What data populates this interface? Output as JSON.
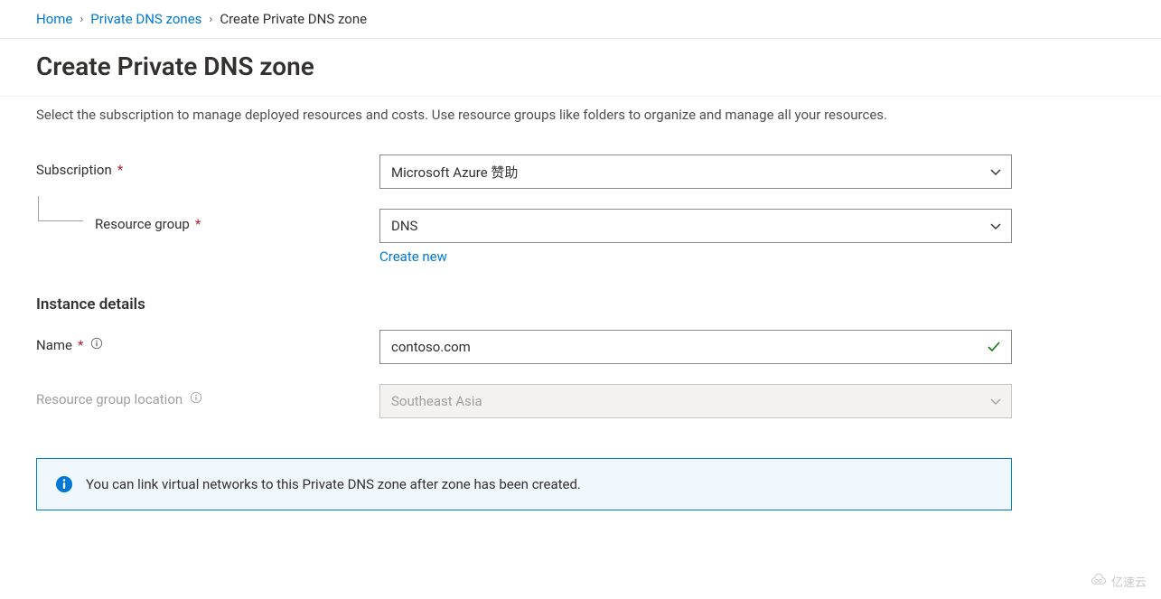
{
  "breadcrumb": {
    "home": "Home",
    "zones": "Private DNS zones",
    "current": "Create Private DNS zone"
  },
  "page_title": "Create Private DNS zone",
  "description": "Select the subscription to manage deployed resources and costs. Use resource groups like folders to organize and manage all your resources.",
  "form": {
    "subscription_label": "Subscription",
    "subscription_value": "Microsoft Azure 赞助",
    "resource_group_label": "Resource group",
    "resource_group_value": "DNS",
    "create_new_label": "Create new",
    "instance_details_heading": "Instance details",
    "name_label": "Name",
    "name_value": "contoso.com",
    "location_label": "Resource group location",
    "location_value": "Southeast Asia"
  },
  "info_banner": "You can link virtual networks to this Private DNS zone after zone has been created.",
  "watermark": "亿速云",
  "colors": {
    "link": "#0078d4",
    "required": "#a4262c",
    "success": "#107c10"
  }
}
